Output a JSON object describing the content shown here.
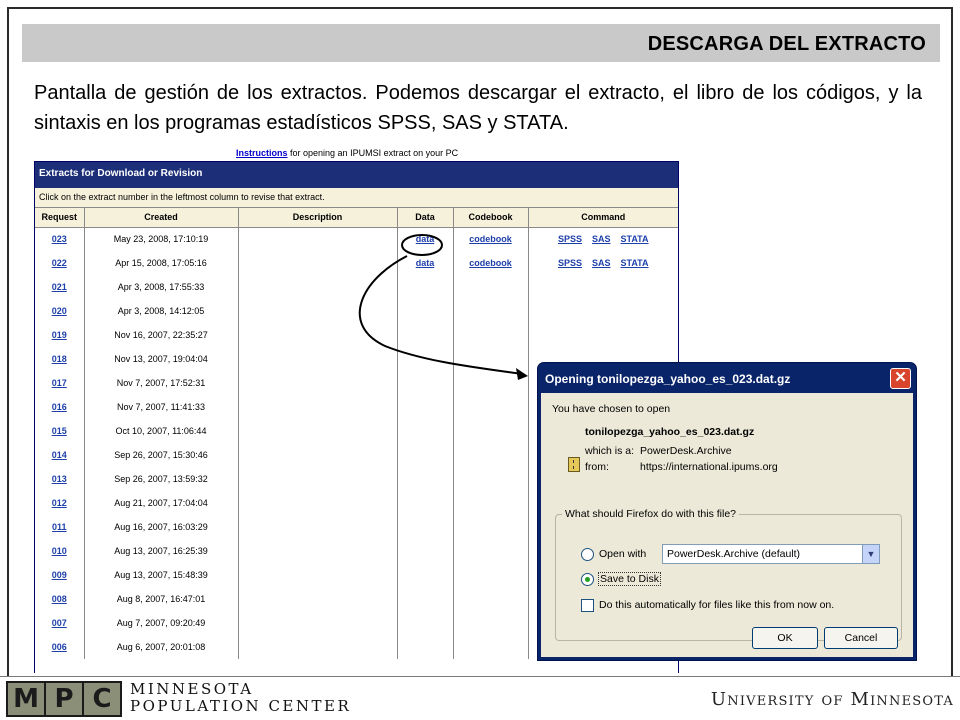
{
  "slide": {
    "title": "DESCARGA DEL EXTRACTO",
    "intro": "Pantalla de gestión de los extractos. Podemos descargar el extracto, el libro de los códigos, y la sintaxis en los programas estadísticos SPSS, SAS y STATA."
  },
  "page": {
    "instructions_link": "Instructions",
    "instructions_rest": " for opening an IPUMSI extract on your PC",
    "panel_title": "Extracts for Download or Revision",
    "panel_hint": "Click on the extract number in the leftmost column to revise that extract.",
    "columns": [
      "Request",
      "Created",
      "Description",
      "Data",
      "Codebook",
      "Command"
    ],
    "data_label": "data",
    "codebook_label": "codebook",
    "commands": [
      "SPSS",
      "SAS",
      "STATA"
    ],
    "rows": [
      {
        "id": "023",
        "created": "May 23, 2008, 17:10:19",
        "files": true
      },
      {
        "id": "022",
        "created": "Apr 15, 2008, 17:05:16",
        "files": true
      },
      {
        "id": "021",
        "created": "Apr 3, 2008, 17:55:33",
        "files": false
      },
      {
        "id": "020",
        "created": "Apr 3, 2008, 14:12:05",
        "files": false
      },
      {
        "id": "019",
        "created": "Nov 16, 2007, 22:35:27",
        "files": false
      },
      {
        "id": "018",
        "created": "Nov 13, 2007, 19:04:04",
        "files": false
      },
      {
        "id": "017",
        "created": "Nov 7, 2007, 17:52:31",
        "files": false
      },
      {
        "id": "016",
        "created": "Nov 7, 2007, 11:41:33",
        "files": false
      },
      {
        "id": "015",
        "created": "Oct 10, 2007, 11:06:44",
        "files": false
      },
      {
        "id": "014",
        "created": "Sep 26, 2007, 15:30:46",
        "files": false
      },
      {
        "id": "013",
        "created": "Sep 26, 2007, 13:59:32",
        "files": false
      },
      {
        "id": "012",
        "created": "Aug 21, 2007, 17:04:04",
        "files": false
      },
      {
        "id": "011",
        "created": "Aug 16, 2007, 16:03:29",
        "files": false
      },
      {
        "id": "010",
        "created": "Aug 13, 2007, 16:25:39",
        "files": false
      },
      {
        "id": "009",
        "created": "Aug 13, 2007, 15:48:39",
        "files": false
      },
      {
        "id": "008",
        "created": "Aug 8, 2007, 16:47:01",
        "files": false
      },
      {
        "id": "007",
        "created": "Aug 7, 2007, 09:20:49",
        "files": false
      },
      {
        "id": "006",
        "created": "Aug 6, 2007, 20:01:08",
        "files": false
      }
    ]
  },
  "dialog": {
    "title": "Opening tonilopezga_yahoo_es_023.dat.gz",
    "chosen": "You have chosen to open",
    "filename": "tonilopezga_yahoo_es_023.dat.gz",
    "which_is_label": "which is a:",
    "which_is_value": "PowerDesk.Archive",
    "from_label": "from:",
    "from_value": "https://international.ipums.org",
    "group_label": "What should Firefox do with this file?",
    "open_with_label": "Open with",
    "open_with_value": "PowerDesk.Archive (default)",
    "save_label": "Save to Disk",
    "auto_label": "Do this automatically for files like this from now on.",
    "ok_label": "OK",
    "cancel_label": "Cancel",
    "open_with_selected": false,
    "save_selected": true,
    "auto_checked": false
  },
  "footer": {
    "logo_letters": [
      "M",
      "P",
      "C"
    ],
    "center_line1": "Minnesota",
    "center_line2": "Population Center",
    "university": "University of Minnesota"
  },
  "colors": {
    "title_bar": "#c9c9c9",
    "panel_header": "#1c2e77",
    "link": "#1d3faa",
    "dialog_title": "#0a246a"
  }
}
